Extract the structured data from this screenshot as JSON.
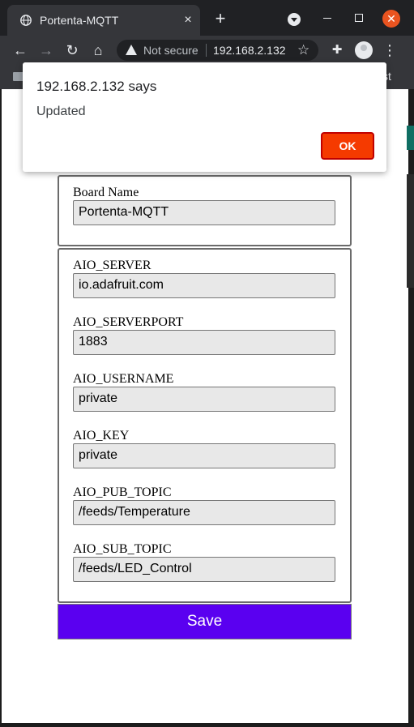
{
  "browser": {
    "tab_title": "Portenta-MQTT",
    "new_tab": "+",
    "tab_close": "×",
    "security_text": "Not secure",
    "url": "192.168.2.132",
    "bookmark_partial": "st"
  },
  "dialog": {
    "title": "192.168.2.132 says",
    "message": "Updated",
    "ok_label": "OK",
    "ok_color": "#f53a00"
  },
  "form": {
    "board_name": {
      "label": "Board Name",
      "value": "Portenta-MQTT"
    },
    "fields": [
      {
        "label": "AIO_SERVER",
        "value": "io.adafruit.com"
      },
      {
        "label": "AIO_SERVERPORT",
        "value": "1883"
      },
      {
        "label": "AIO_USERNAME",
        "value": "private"
      },
      {
        "label": "AIO_KEY",
        "value": "private"
      },
      {
        "label": "AIO_PUB_TOPIC",
        "value": "/feeds/Temperature"
      },
      {
        "label": "AIO_SUB_TOPIC",
        "value": "/feeds/LED_Control"
      }
    ],
    "save_label": "Save",
    "save_color": "#5a00f0"
  },
  "icons": {
    "globe": "globe-icon",
    "back": "arrow-left-icon",
    "forward": "arrow-right-icon",
    "reload": "reload-icon",
    "home": "home-icon",
    "warning": "warning-icon",
    "star": "star-icon",
    "extensions": "puzzle-icon",
    "profile": "avatar-icon",
    "menu": "more-vert-icon",
    "folder": "folder-icon"
  }
}
